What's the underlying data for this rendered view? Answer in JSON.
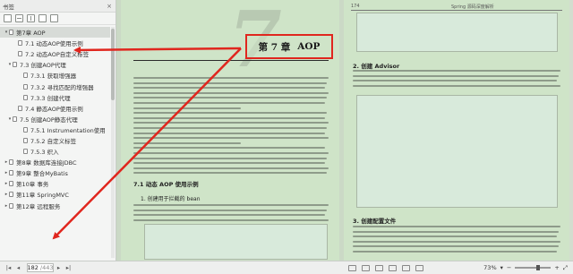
{
  "sidebar": {
    "title": "书签",
    "close": "×",
    "items": [
      {
        "label": "第7章  AOP",
        "exp": "▾",
        "indent": 4,
        "selected": true
      },
      {
        "label": "7.1  动态AOP使用示例",
        "exp": "",
        "indent": 14
      },
      {
        "label": "7.2  动态AOP自定义标签",
        "exp": "",
        "indent": 14
      },
      {
        "label": "7.3  创建AOP代理",
        "exp": "▾",
        "indent": 8
      },
      {
        "label": "7.3.1  获取增强器",
        "exp": "",
        "indent": 20
      },
      {
        "label": "7.3.2  寻找匹配的增强器",
        "exp": "",
        "indent": 20
      },
      {
        "label": "7.3.3  创建代理",
        "exp": "",
        "indent": 20
      },
      {
        "label": "7.4  静态AOP使用示例",
        "exp": "",
        "indent": 14
      },
      {
        "label": "7.5  创建AOP静态代理",
        "exp": "▾",
        "indent": 8
      },
      {
        "label": "7.5.1  Instrumentation使用",
        "exp": "",
        "indent": 20
      },
      {
        "label": "7.5.2  自定义标签",
        "exp": "",
        "indent": 20
      },
      {
        "label": "7.5.3  织入",
        "exp": "",
        "indent": 20
      },
      {
        "label": "第8章  数据库连接JDBC",
        "exp": "▸",
        "indent": 4
      },
      {
        "label": "第9章  整合MyBatis",
        "exp": "▸",
        "indent": 4
      },
      {
        "label": "第10章  事务",
        "exp": "▸",
        "indent": 4
      },
      {
        "label": "第11章  SpringMVC",
        "exp": "▸",
        "indent": 4
      },
      {
        "label": "第12章  远程服务",
        "exp": "▸",
        "indent": 4
      }
    ]
  },
  "page_left": {
    "big_number": "7",
    "chapter_num": "第 7 章",
    "chapter_title": "AOP",
    "section_heading": "7.1   动态 AOP 使用示例",
    "subsection_heading": "1. 创建用于拦截的 bean"
  },
  "page_right": {
    "page_number": "174",
    "header": "Spring 源码深度解析",
    "sub_heading_2": "2. 创建 Advisor",
    "sub_heading_3": "3. 创建配置文件"
  },
  "status": {
    "first": "|◂",
    "prev": "◂",
    "page_current": "182",
    "page_total": "/443",
    "next": "▸",
    "last": "▸|",
    "zoom_out": "−",
    "zoom_level": "73%",
    "zoom_in": "+",
    "zoom_fraction": 0.6,
    "zoom_dropdown": "▾",
    "fit": "⤢"
  },
  "colors": {
    "annotation": "#e0261e",
    "page_bg": "#cfe4c8"
  }
}
